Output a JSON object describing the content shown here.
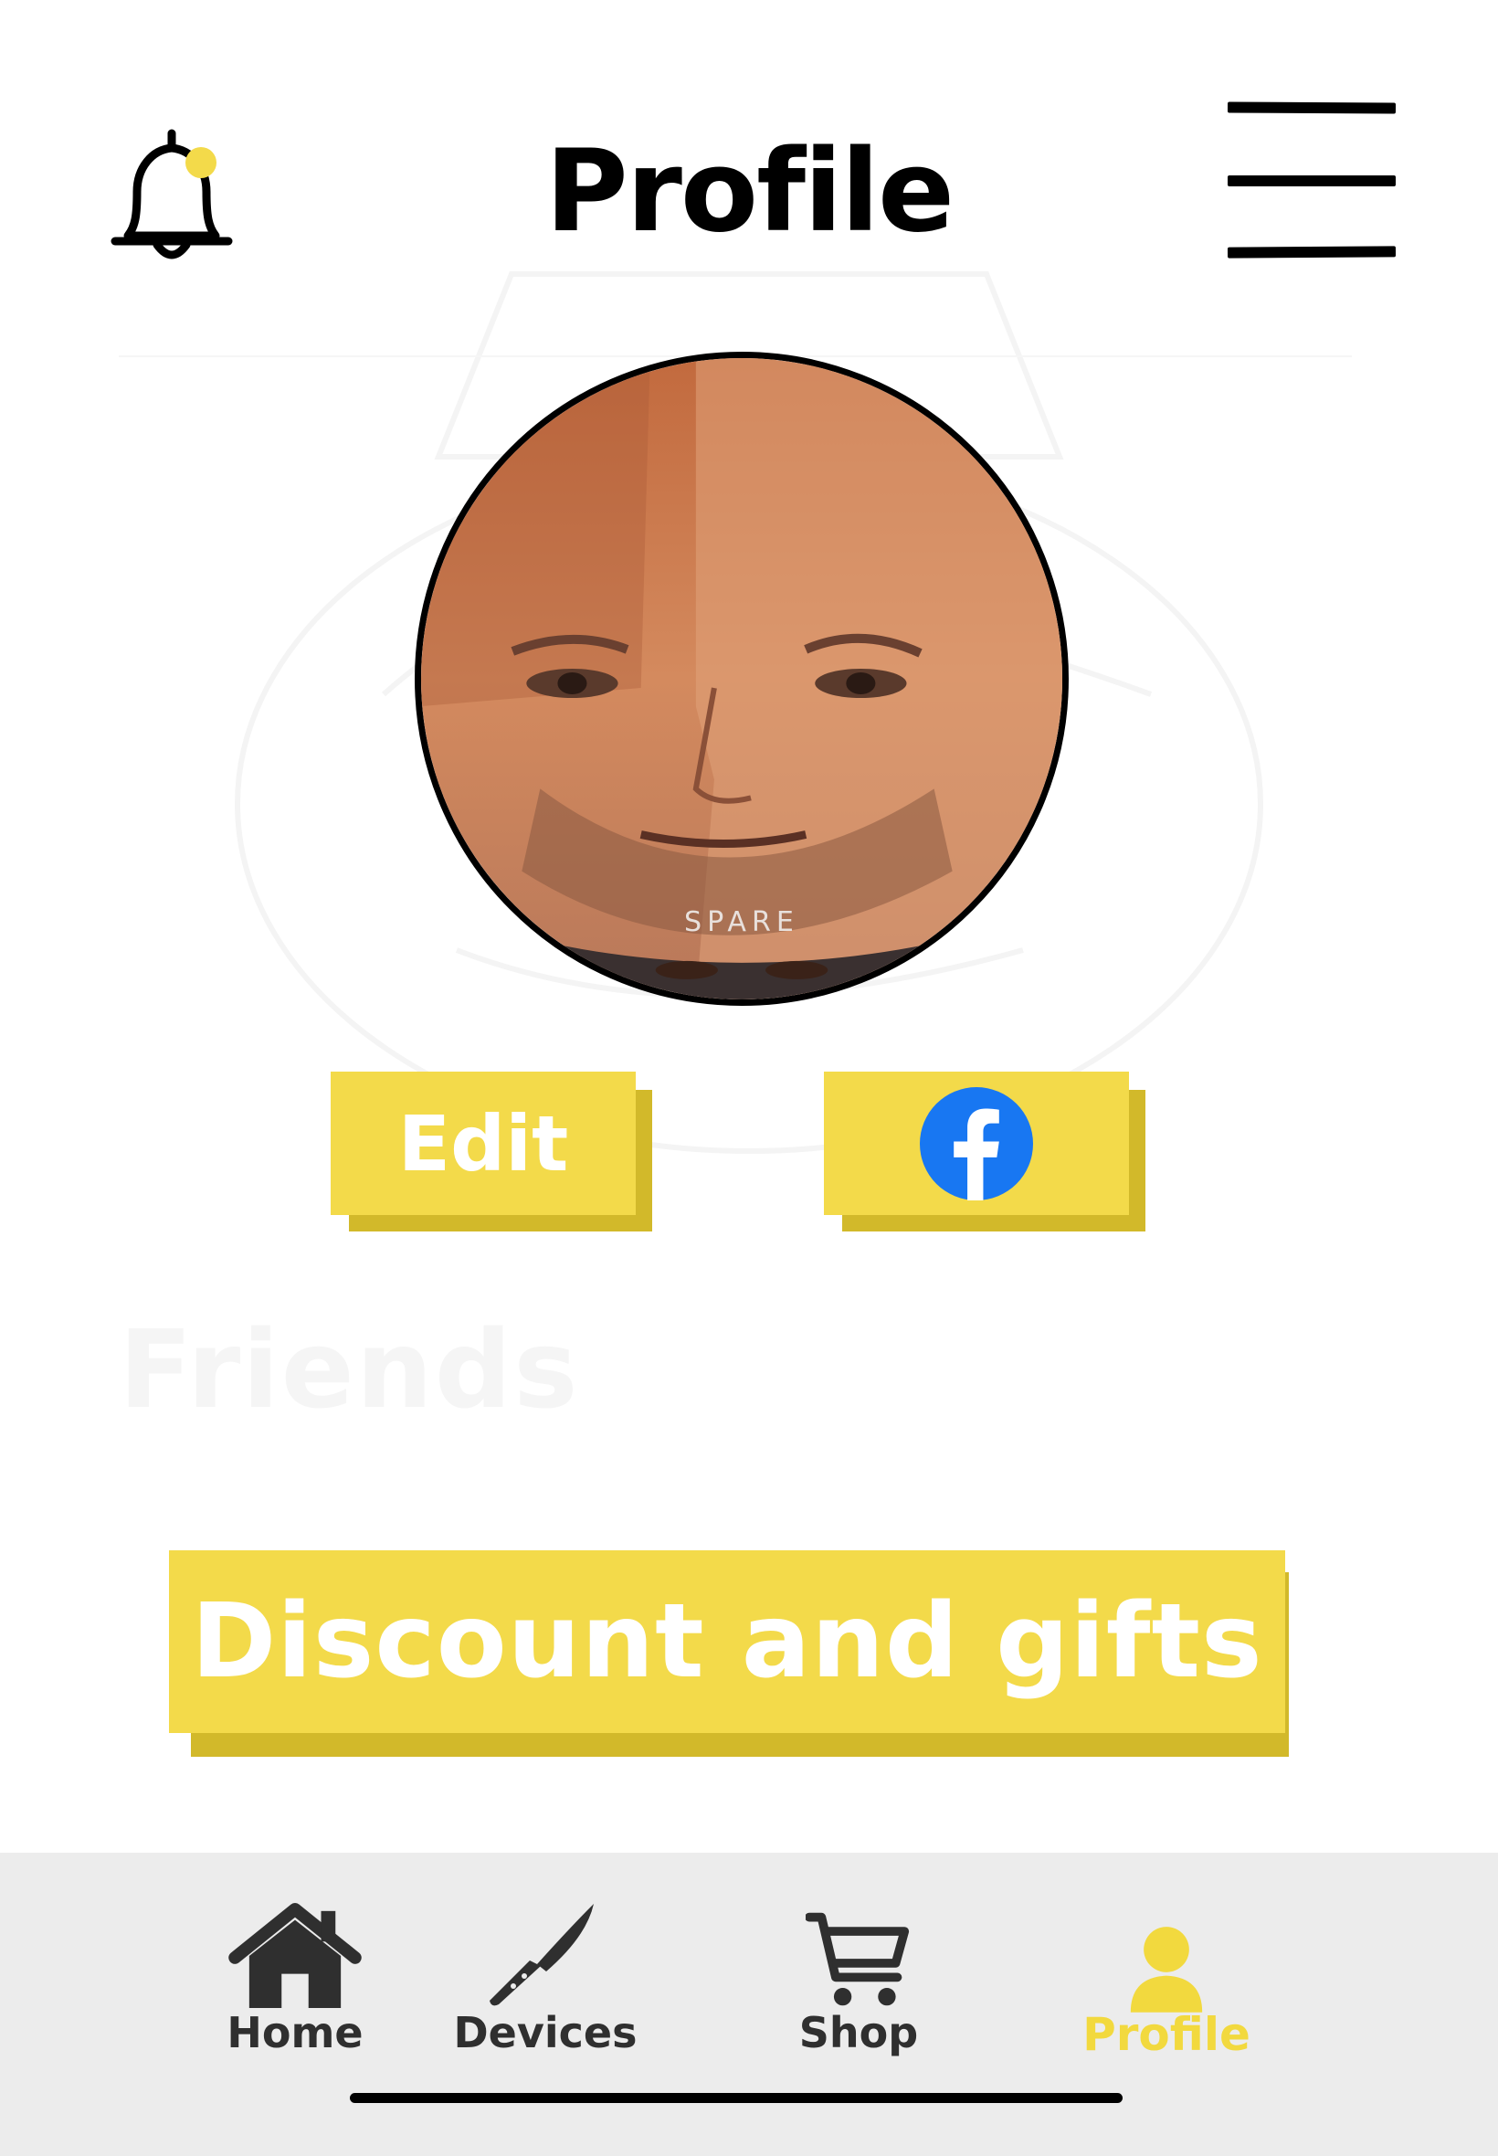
{
  "header": {
    "title": "Profile",
    "notification_icon": "bell-icon",
    "notification_dot_color": "#f3da4a",
    "menu_icon": "hamburger-menu-icon"
  },
  "profile": {
    "avatar_caption": "SPARE"
  },
  "buttons": {
    "edit_label": "Edit",
    "facebook_icon": "facebook-icon",
    "discount_label": "Discount and gifts"
  },
  "background": {
    "ghost_heading": "Friends"
  },
  "nav": {
    "items": [
      {
        "label": "Home",
        "icon": "home-icon",
        "active": false
      },
      {
        "label": "Devices",
        "icon": "knife-icon",
        "active": false
      },
      {
        "label": "Shop",
        "icon": "cart-icon",
        "active": false
      },
      {
        "label": "Profile",
        "icon": "user-icon",
        "active": true
      }
    ]
  },
  "colors": {
    "accent_yellow": "#f3da4a",
    "accent_yellow_shadow": "#d2b92a",
    "nav_background": "#ececec",
    "facebook_blue": "#1877f2"
  }
}
